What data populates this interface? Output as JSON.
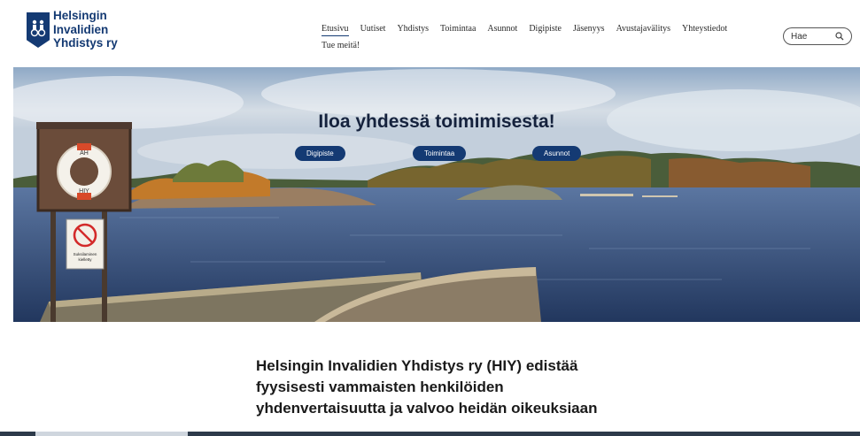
{
  "brand": {
    "name_lines": [
      "Helsingin",
      "Invalidien",
      "Yhdistys ry"
    ],
    "color": "#143a73"
  },
  "nav": {
    "items": [
      {
        "label": "Etusivu",
        "active": true
      },
      {
        "label": "Uutiset"
      },
      {
        "label": "Yhdistys"
      },
      {
        "label": "Toimintaa"
      },
      {
        "label": "Asunnot"
      },
      {
        "label": "Digipiste"
      },
      {
        "label": "Jäsenyys"
      },
      {
        "label": "Avustajavälitys"
      },
      {
        "label": "Yhteystiedot"
      }
    ],
    "second_row": {
      "label": "Tue meitä!"
    }
  },
  "search": {
    "placeholder": "Hae",
    "icon": "search-icon"
  },
  "hero": {
    "title": "Iloa yhdessä toimimisesta!",
    "buttons": [
      {
        "label": "Digipiste"
      },
      {
        "label": "Toimintaa"
      },
      {
        "label": "Asunnot"
      }
    ],
    "lifebuoy_text_top": "AH",
    "lifebuoy_text_bottom": "HIY",
    "sign_text": [
      "Suksilaminen",
      "kielletty"
    ]
  },
  "intro": {
    "text": "Helsingin Invalidien Yhdistys ry (HIY) edistää fyysisesti vammaisten henkilöiden yhdenvertaisuutta ja valvoo heidän oikeuksiaan"
  },
  "colors": {
    "accent": "#143a73"
  }
}
